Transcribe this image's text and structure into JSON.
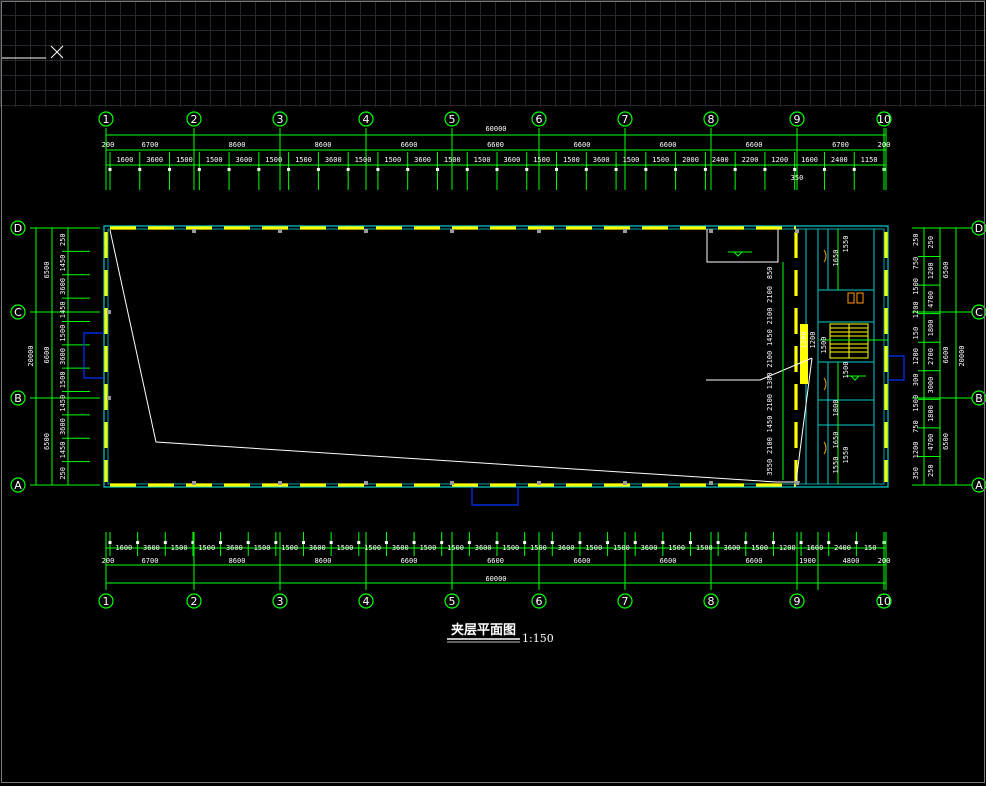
{
  "drawing": {
    "title": "夹层平面图",
    "scale": "1:150"
  },
  "axes": {
    "columns": [
      "1",
      "2",
      "3",
      "4",
      "5",
      "6",
      "7",
      "8",
      "9",
      "10"
    ],
    "rows": [
      "A",
      "B",
      "C",
      "D"
    ]
  },
  "dims": {
    "top_total": "60000",
    "top_spans": [
      "6700",
      "8600",
      "8600",
      "6600",
      "6600",
      "6600",
      "6600",
      "6600",
      "6700"
    ],
    "top_edge": [
      "200",
      "200"
    ],
    "top_detail": [
      "1600",
      "3600",
      "1500",
      "1500",
      "3600",
      "1500",
      "1500",
      "3600",
      "1500",
      "1500",
      "3600",
      "1500",
      "1500",
      "3600",
      "1500",
      "1500",
      "3600",
      "1500",
      "1500",
      "2000",
      "2400",
      "2200",
      "1200",
      "1600",
      "2400",
      "1150"
    ],
    "top_extra": "350",
    "bottom_total": "60000",
    "bottom_spans": [
      "6700",
      "8600",
      "8600",
      "6600",
      "6600",
      "6600",
      "6600",
      "6600",
      "1900",
      "4800"
    ],
    "bottom_edge": [
      "200",
      "200"
    ],
    "bottom_detail": [
      "1600",
      "3600",
      "1500",
      "1500",
      "3600",
      "1500",
      "1500",
      "3600",
      "1500",
      "1500",
      "3600",
      "1500",
      "1500",
      "3600",
      "1500",
      "1500",
      "3600",
      "1500",
      "1500",
      "3600",
      "1500",
      "1500",
      "3600",
      "1500",
      "1200",
      "1600",
      "2400",
      "150"
    ],
    "left_total": "20000",
    "left_spans": [
      "6500",
      "6600",
      "6500"
    ],
    "left_detail": [
      "250",
      "1450",
      "3600",
      "1450",
      "1500",
      "3600",
      "1500",
      "1450",
      "3600",
      "1450",
      "250"
    ],
    "right_total": "20000",
    "right_spans": [
      "6500",
      "6600",
      "6500"
    ],
    "right_detail": [
      "250",
      "1200",
      "4700",
      "1800",
      "2700",
      "3000",
      "1800",
      "4700",
      "250"
    ],
    "right_fine": [
      "250",
      "750",
      "1500",
      "1200",
      "150",
      "1200",
      "300",
      "1500",
      "750",
      "1200",
      "350"
    ],
    "stair_dims": [
      "1200",
      "1200",
      "1500",
      "1650",
      "1550",
      "1800",
      "1650",
      "1550",
      "1500",
      "1550"
    ],
    "interior_dims": [
      "850",
      "2100",
      "2100",
      "1450",
      "2100",
      "1300",
      "2100",
      "1450",
      "2100",
      "3550"
    ]
  }
}
